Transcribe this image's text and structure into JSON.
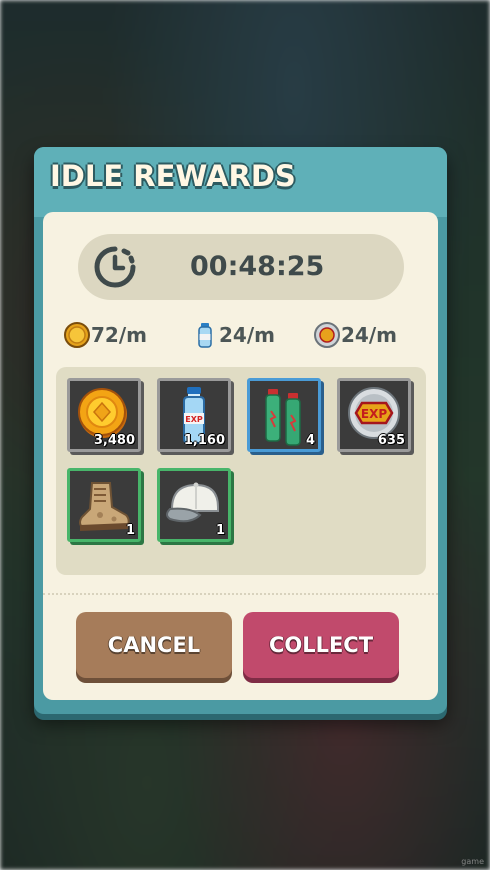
{
  "dialog": {
    "title": "IDLE REWARDS",
    "timer": {
      "icon": "stopwatch-icon",
      "value": "00:48:25"
    },
    "rates": [
      {
        "icon": "coin-icon",
        "text": "72/m"
      },
      {
        "icon": "exp-bottle-icon",
        "text": "24/m"
      },
      {
        "icon": "exp-token-icon",
        "text": "24/m"
      }
    ],
    "items": [
      {
        "icon": "gold-coin-icon",
        "qty": "3,480",
        "rarity": "common"
      },
      {
        "icon": "exp-bottle-icon",
        "qty": "1,160",
        "rarity": "common"
      },
      {
        "icon": "energy-drink-icon",
        "qty": "4",
        "rarity": "rare"
      },
      {
        "icon": "exp-token-icon",
        "qty": "635",
        "rarity": "common"
      },
      {
        "icon": "hiking-boot-icon",
        "qty": "1",
        "rarity": "uncommon"
      },
      {
        "icon": "baseball-cap-icon",
        "qty": "1",
        "rarity": "uncommon"
      }
    ],
    "buttons": {
      "cancel": "CANCEL",
      "collect": "COLLECT"
    }
  },
  "colors": {
    "frame": "#4b9aa3",
    "panel": "#f7f2e1",
    "cancel": "#a67c5a",
    "collect": "#c14a6c",
    "rare_border": "#4a9bd6",
    "uncommon_border": "#48b56a"
  },
  "watermark": "game"
}
